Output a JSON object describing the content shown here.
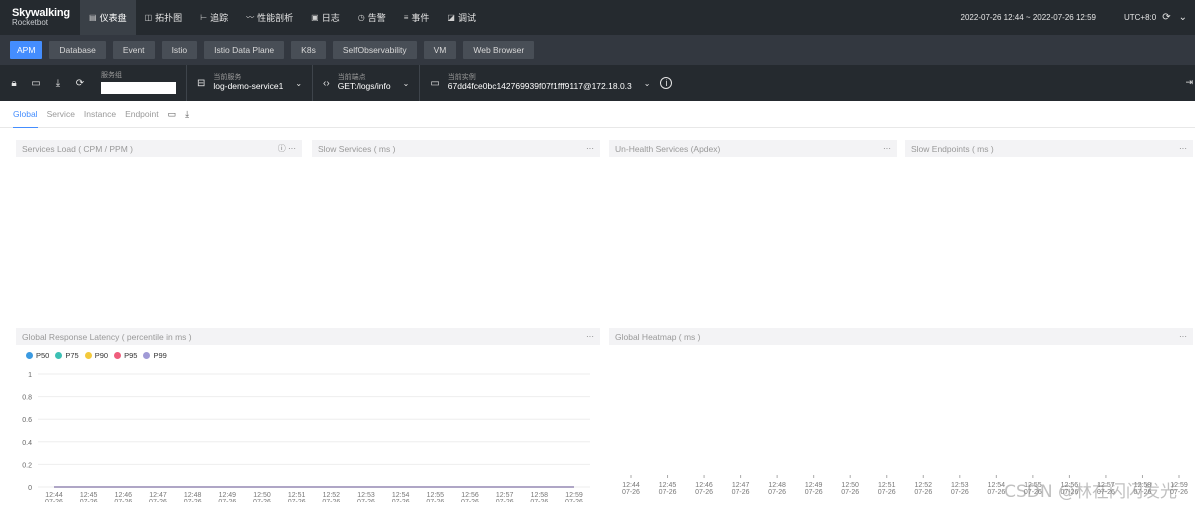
{
  "brand": {
    "name": "Skywalking",
    "sub": "Rocketbot"
  },
  "nav": [
    {
      "icon": "▤",
      "label": "仪表盘",
      "active": true
    },
    {
      "icon": "◫",
      "label": "拓扑图"
    },
    {
      "icon": "⊢",
      "label": "追踪"
    },
    {
      "icon": "〰",
      "label": "性能剖析"
    },
    {
      "icon": "▣",
      "label": "日志"
    },
    {
      "icon": "◷",
      "label": "告警"
    },
    {
      "icon": "≡",
      "label": "事件"
    },
    {
      "icon": "◪",
      "label": "调试"
    }
  ],
  "topbar": {
    "time_range": "2022-07-26 12:44 ~ 2022-07-26 12:59",
    "timezone": "UTC+8:0"
  },
  "layers": [
    "APM",
    "Database",
    "Event",
    "Istio",
    "Istio Data Plane",
    "K8s",
    "SelfObservability",
    "VM",
    "Web Browser"
  ],
  "selectors": {
    "group": {
      "label": "服务组",
      "value": ""
    },
    "service": {
      "label": "当前服务",
      "value": "log-demo-service1"
    },
    "endpoint": {
      "label": "当前端点",
      "value": "GET:/logs/info"
    },
    "instance": {
      "label": "当前实例",
      "value": "67dd4fce0bc142769939f07f1fff9117@172.18.0.3"
    }
  },
  "tabs": [
    "Global",
    "Service",
    "Instance",
    "Endpoint"
  ],
  "panels": {
    "services_load": "Services Load ( CPM / PPM )",
    "slow_services": "Slow Services ( ms )",
    "unhealth_services": "Un-Health Services (Apdex)",
    "slow_endpoints": "Slow Endpoints ( ms )",
    "latency": "Global Response Latency ( percentile in ms )",
    "heatmap": "Global Heatmap ( ms )",
    "more": "···",
    "info": "ⓘ"
  },
  "chart_data": [
    {
      "type": "line",
      "title": "Global Response Latency ( percentile in ms )",
      "x": [
        "12:44\n07-26",
        "12:45\n07-26",
        "12:46\n07-26",
        "12:47\n07-26",
        "12:48\n07-26",
        "12:49\n07-26",
        "12:50\n07-26",
        "12:51\n07-26",
        "12:52\n07-26",
        "12:53\n07-26",
        "12:54\n07-26",
        "12:55\n07-26",
        "12:56\n07-26",
        "12:57\n07-26",
        "12:58\n07-26",
        "12:59\n07-26"
      ],
      "series": [
        {
          "name": "P50",
          "color": "#3b9ae1",
          "values": [
            0,
            0,
            0,
            0,
            0,
            0,
            0,
            0,
            0,
            0,
            0,
            0,
            0,
            0,
            0,
            0
          ]
        },
        {
          "name": "P75",
          "color": "#3cc0b4",
          "values": [
            0,
            0,
            0,
            0,
            0,
            0,
            0,
            0,
            0,
            0,
            0,
            0,
            0,
            0,
            0,
            0
          ]
        },
        {
          "name": "P90",
          "color": "#f3c93b",
          "values": [
            0,
            0,
            0,
            0,
            0,
            0,
            0,
            0,
            0,
            0,
            0,
            0,
            0,
            0,
            0,
            0
          ]
        },
        {
          "name": "P95",
          "color": "#ef5d7c",
          "values": [
            0,
            0,
            0,
            0,
            0,
            0,
            0,
            0,
            0,
            0,
            0,
            0,
            0,
            0,
            0,
            0
          ]
        },
        {
          "name": "P99",
          "color": "#a09ad6",
          "values": [
            0,
            0,
            0,
            0,
            0,
            0,
            0,
            0,
            0,
            0,
            0,
            0,
            0,
            0,
            0,
            0
          ]
        }
      ],
      "ylim": [
        0,
        1
      ],
      "yticks": [
        "0",
        "0.2",
        "0.4",
        "0.6",
        "0.8",
        "1"
      ],
      "grid": true,
      "legend": "top-left"
    },
    {
      "type": "heatmap",
      "title": "Global Heatmap ( ms )",
      "x": [
        "12:44\n07-26",
        "12:45\n07-26",
        "12:46\n07-26",
        "12:47\n07-26",
        "12:48\n07-26",
        "12:49\n07-26",
        "12:50\n07-26",
        "12:51\n07-26",
        "12:52\n07-26",
        "12:53\n07-26",
        "12:54\n07-26",
        "12:55\n07-26",
        "12:56\n07-26",
        "12:57\n07-26",
        "12:58\n07-26",
        "12:59\n07-26"
      ],
      "values": []
    }
  ],
  "watermark": "CSDN @林在闪闪发光"
}
